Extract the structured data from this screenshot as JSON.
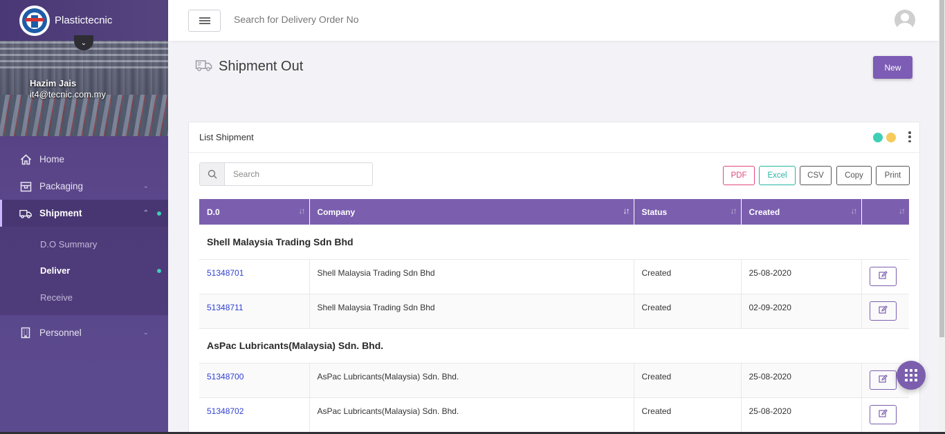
{
  "brand": {
    "name": "Plastictecnic"
  },
  "user": {
    "name": "Hazim Jais",
    "email": "it4@tecnic.com.my"
  },
  "nav": {
    "home": "Home",
    "packaging": "Packaging",
    "shipment": "Shipment",
    "sub": [
      "D.O Summary",
      "Deliver",
      "Receive"
    ],
    "personnel": "Personnel"
  },
  "topbar": {
    "search_placeholder": "Search for Delivery Order No"
  },
  "page": {
    "title": "Shipment Out",
    "new_label": "New"
  },
  "card": {
    "title": "List Shipment",
    "search_placeholder": "Search",
    "status_colors": [
      "#3ecfb7",
      "#f5cb5c"
    ],
    "export_buttons": [
      {
        "label": "PDF",
        "color": "#e0467c"
      },
      {
        "label": "Excel",
        "color": "#26b5a5"
      },
      {
        "label": "CSV",
        "color": "#555555"
      },
      {
        "label": "Copy",
        "color": "#555555"
      },
      {
        "label": "Print",
        "color": "#555555"
      }
    ]
  },
  "table": {
    "columns": [
      "D.0",
      "Company",
      "Status",
      "Created",
      ""
    ],
    "groups": [
      {
        "name": "Shell Malaysia Trading Sdn Bhd",
        "rows": [
          {
            "do": "51348701",
            "company": "Shell Malaysia Trading Sdn Bhd",
            "status": "Created",
            "created": "25-08-2020"
          },
          {
            "do": "51348711",
            "company": "Shell Malaysia Trading Sdn Bhd",
            "status": "Created",
            "created": "02-09-2020"
          }
        ]
      },
      {
        "name": "AsPac Lubricants(Malaysia) Sdn. Bhd.",
        "rows": [
          {
            "do": "51348700",
            "company": "AsPac Lubricants(Malaysia) Sdn. Bhd.",
            "status": "Created",
            "created": "25-08-2020"
          },
          {
            "do": "51348702",
            "company": "AsPac Lubricants(Malaysia) Sdn. Bhd.",
            "status": "Created",
            "created": "25-08-2020"
          }
        ]
      }
    ]
  },
  "colors": {
    "accent": "#7b5fae",
    "sidebar": "#4e3a7a",
    "link": "#2f3fd0"
  }
}
